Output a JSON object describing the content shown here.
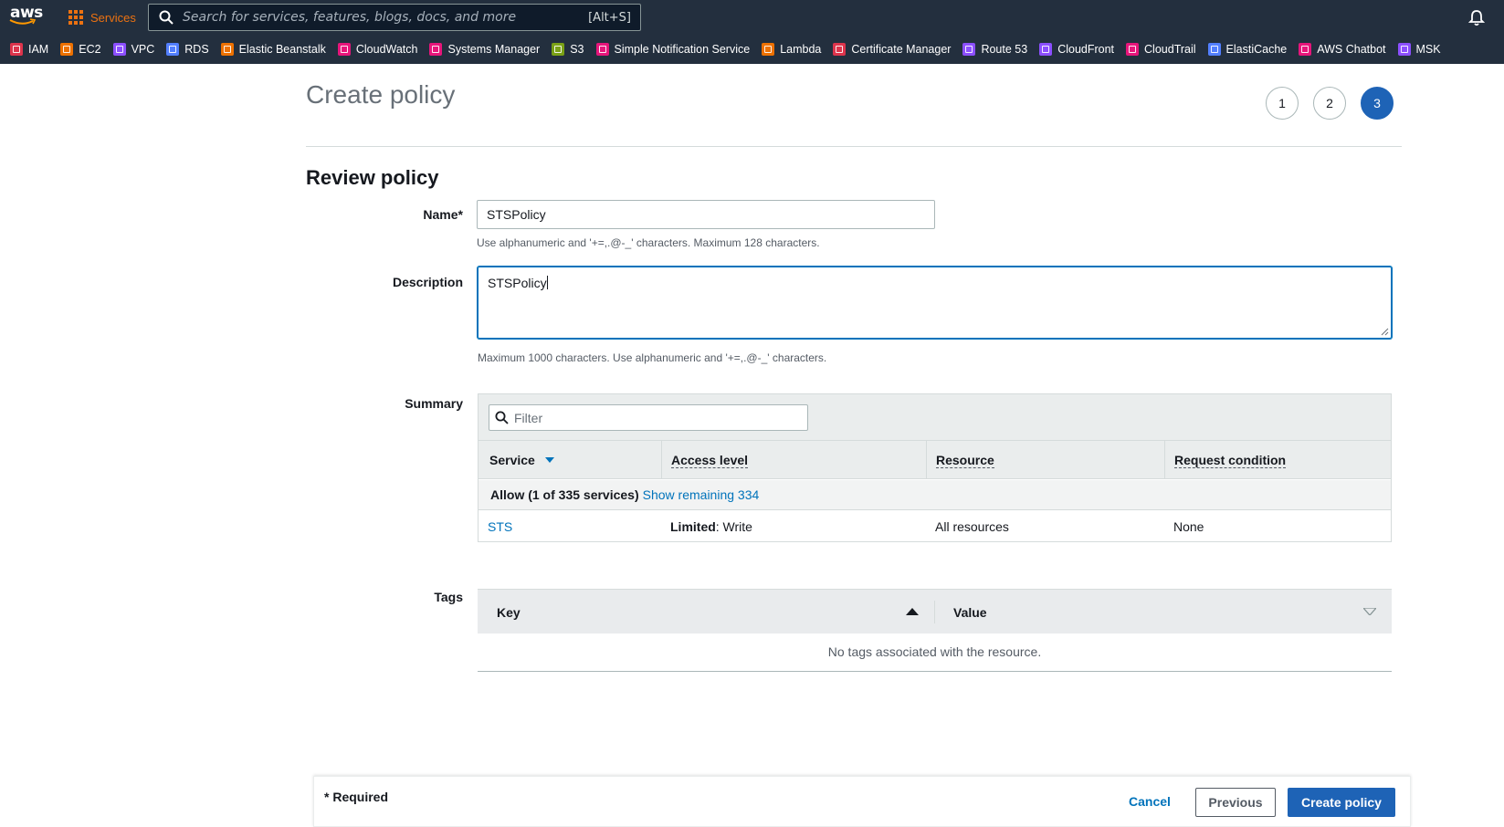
{
  "nav": {
    "logo": "aws",
    "services_label": "Services",
    "search_placeholder": "Search for services, features, blogs, docs, and more",
    "search_shortcut": "[Alt+S]",
    "bell_icon": "bell-icon"
  },
  "favorites": [
    {
      "label": "IAM",
      "color": "#dd344c"
    },
    {
      "label": "EC2",
      "color": "#ed7100"
    },
    {
      "label": "VPC",
      "color": "#8c4fff"
    },
    {
      "label": "RDS",
      "color": "#527fff"
    },
    {
      "label": "Elastic Beanstalk",
      "color": "#ed7100"
    },
    {
      "label": "CloudWatch",
      "color": "#e7157b"
    },
    {
      "label": "Systems Manager",
      "color": "#e7157b"
    },
    {
      "label": "S3",
      "color": "#7aa116"
    },
    {
      "label": "Simple Notification Service",
      "color": "#e7157b"
    },
    {
      "label": "Lambda",
      "color": "#ed7100"
    },
    {
      "label": "Certificate Manager",
      "color": "#dd344c"
    },
    {
      "label": "Route 53",
      "color": "#8c4fff"
    },
    {
      "label": "CloudFront",
      "color": "#8c4fff"
    },
    {
      "label": "CloudTrail",
      "color": "#e7157b"
    },
    {
      "label": "ElastiCache",
      "color": "#527fff"
    },
    {
      "label": "AWS Chatbot",
      "color": "#e7157b"
    },
    {
      "label": "MSK",
      "color": "#8c4fff"
    }
  ],
  "page": {
    "title": "Create policy",
    "steps": [
      "1",
      "2",
      "3"
    ],
    "active_step": 3,
    "section_title": "Review policy"
  },
  "form": {
    "name_label": "Name*",
    "name_value": "STSPolicy",
    "name_hint": "Use alphanumeric and '+=,.@-_' characters. Maximum 128 characters.",
    "description_label": "Description",
    "description_value": "STSPolicy",
    "description_hint": "Maximum 1000 characters. Use alphanumeric and '+=,.@-_' characters."
  },
  "summary": {
    "label": "Summary",
    "filter_placeholder": "Filter",
    "columns": [
      "Service",
      "Access level",
      "Resource",
      "Request condition"
    ],
    "allow_text": "Allow (1 of 335 services)",
    "show_remaining": "Show remaining 334",
    "rows": [
      {
        "service": "STS",
        "access_bold": "Limited",
        "access_rest": ": Write",
        "resource": "All resources",
        "condition": "None"
      }
    ]
  },
  "tags": {
    "label": "Tags",
    "columns": [
      "Key",
      "Value"
    ],
    "empty_text": "No tags associated with the resource."
  },
  "footer": {
    "required_note": "* Required",
    "cancel": "Cancel",
    "previous": "Previous",
    "create": "Create policy"
  }
}
